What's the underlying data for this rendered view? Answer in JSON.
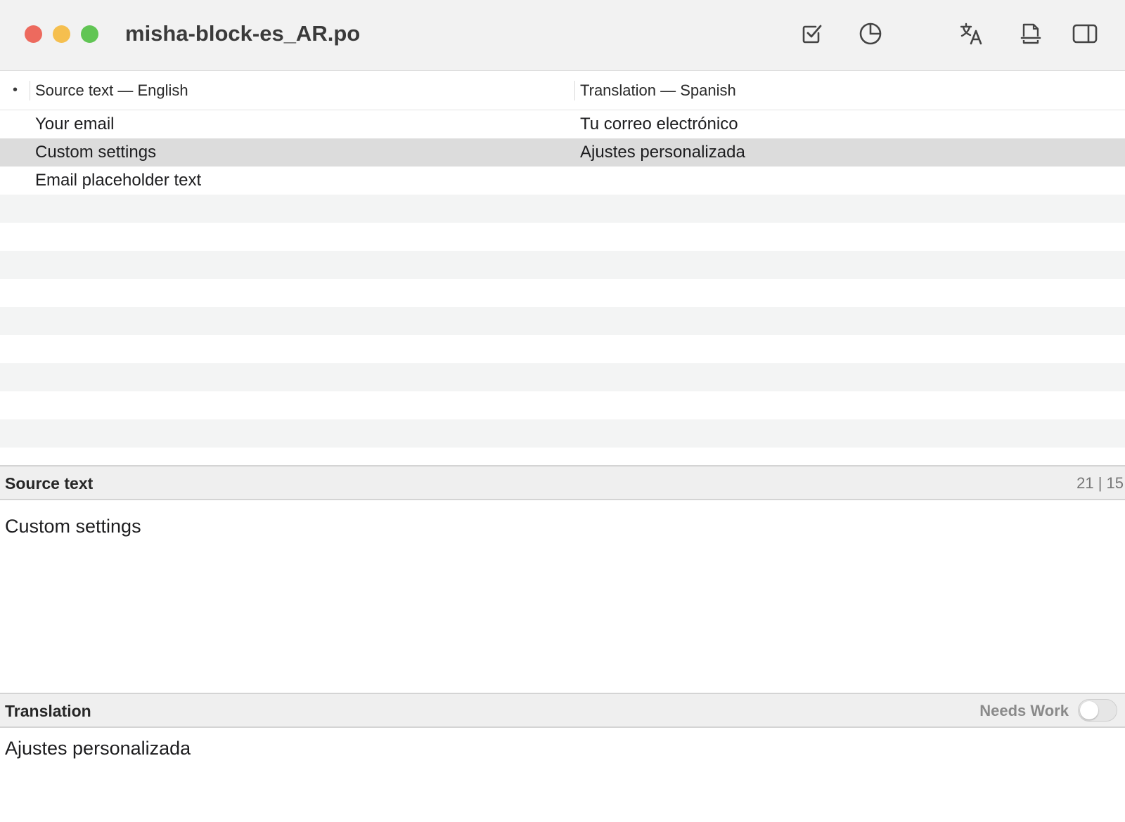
{
  "window": {
    "title": "misha-block-es_AR.po"
  },
  "toolbar": {
    "icons": [
      "checkmark-square-icon",
      "pie-chart-icon",
      "translate-icon",
      "document-icon",
      "sidebar-icon"
    ]
  },
  "table": {
    "header": {
      "source": "Source text — English",
      "translation": "Translation — Spanish"
    },
    "rows": [
      {
        "source": "Your email",
        "translation": "Tu correo electrónico",
        "selected": false
      },
      {
        "source": "Custom settings",
        "translation": "Ajustes personalizada",
        "selected": true
      },
      {
        "source": "Email placeholder text",
        "translation": "",
        "selected": false
      }
    ]
  },
  "source_panel": {
    "label": "Source text",
    "counts": "21 | 15",
    "text": "Custom settings"
  },
  "translation_panel": {
    "label": "Translation",
    "needs_work_label": "Needs Work",
    "needs_work_on": false,
    "text": "Ajustes personalizada"
  }
}
